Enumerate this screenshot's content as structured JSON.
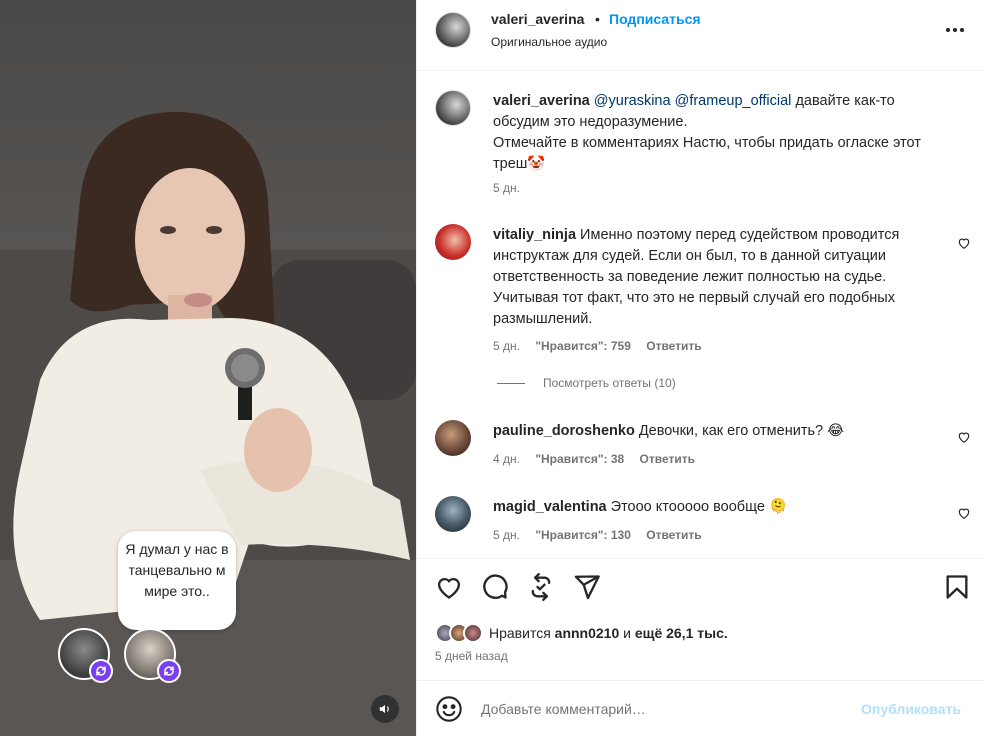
{
  "video": {
    "caption_bubble": "Я думал у нас в танцевально м мире это..",
    "collab_avatar_1": "avatar",
    "collab_avatar_2": "avatar",
    "remix_icon": "remix-icon",
    "mute_icon": "speaker-icon"
  },
  "header": {
    "username": "valeri_averina",
    "separator": "•",
    "follow_label": "Подписаться",
    "audio_label": "Оригинальное аудио",
    "more_icon": "more-horizontal-icon"
  },
  "caption": {
    "username": "valeri_averina",
    "mention_1": "@yuraskina",
    "mention_2": "@frameup_official",
    "text_1": "давайте как-то обсудим это недоразумение.",
    "text_2": "Отмечайте в комментариях Настю, чтобы придать огласке этот треш🤡",
    "time": "5 дн."
  },
  "comments": [
    {
      "username": "vitaliy_ninja",
      "text": "Именно поэтому перед судейством проводится инструктаж для судей. Если он был, то в данной ситуации ответственность за поведение лежит полностью на судье. Учитывая тот факт, что это не первый случай его подобных размышлений.",
      "time": "5 дн.",
      "likes": "\"Нравится\": 759",
      "reply": "Ответить",
      "view_replies": "Посмотреть ответы (10)"
    },
    {
      "username": "pauline_doroshenko",
      "text": "Девочки, как его отменить? 😂",
      "time": "4 дн.",
      "likes": "\"Нравится\": 38",
      "reply": "Ответить"
    },
    {
      "username": "magid_valentina",
      "text": "Этооо ктооооо вообще 🫠",
      "time": "5 дн.",
      "likes": "\"Нравится\": 130",
      "reply": "Ответить"
    }
  ],
  "actions": {
    "like_icon": "heart-icon",
    "comment_icon": "comment-icon",
    "repost_icon": "repost-icon",
    "share_icon": "send-icon",
    "save_icon": "bookmark-icon",
    "likes_prefix": "Нравится",
    "likes_user": "annn0210",
    "likes_and": "и",
    "likes_rest": "ещё 26,1 тыс.",
    "time_ago": "5 дней назад"
  },
  "composer": {
    "emoji_icon": "emoji-icon",
    "placeholder": "Добавьте комментарий…",
    "publish_label": "Опубликовать"
  },
  "colors": {
    "accent": "#0095f6",
    "publish_disabled": "#b2dffc",
    "remix_badge": "#7b3ff2",
    "text_primary": "#262626",
    "text_secondary": "#737373"
  }
}
